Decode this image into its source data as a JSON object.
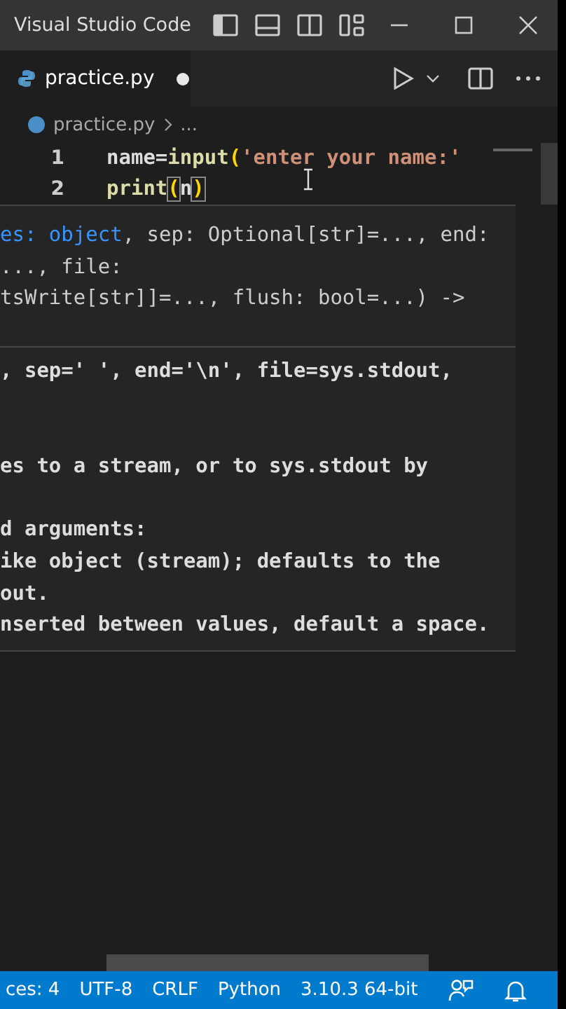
{
  "title_bar": {
    "title": "Visual Studio Code"
  },
  "tab": {
    "label": "practice.py",
    "modified": true
  },
  "breadcrumb": {
    "file": "practice.py",
    "rest": "..."
  },
  "code_lines": [
    {
      "number": "1",
      "segments": [
        {
          "text": "name",
          "kind": "variable"
        },
        {
          "text": "=",
          "kind": "operator"
        },
        {
          "text": "input",
          "kind": "function"
        },
        {
          "text": "(",
          "kind": "bracket"
        },
        {
          "text": "'enter your name:'",
          "kind": "string"
        }
      ]
    },
    {
      "number": "2",
      "segments": [
        {
          "text": "print",
          "kind": "function"
        },
        {
          "text": "(",
          "kind": "matched_bracket"
        },
        {
          "text": "n",
          "kind": "variable"
        },
        {
          "text": ")",
          "kind": "matched_bracket"
        }
      ]
    }
  ],
  "hover": {
    "signature": [
      [
        {
          "text": "es: object",
          "kind": "param"
        },
        {
          "text": ", sep: Optional[str]=..., end:",
          "kind": "plain"
        }
      ],
      [
        {
          "text": "..., file:",
          "kind": "plain"
        }
      ],
      [
        {
          "text": "tsWrite[str]]=..., flush: bool=...) ->",
          "kind": "plain"
        }
      ]
    ],
    "doc": [
      [
        ", sep=' ', end='\\n', file=sys.stdout,"
      ],
      [
        "es to a stream, or to sys.stdout by"
      ],
      [
        "d arguments:",
        "ike object (stream); defaults to the",
        "out.",
        "nserted between values, default a space."
      ]
    ]
  },
  "status_bar": {
    "items": [
      "ces: 4",
      "UTF-8",
      "CRLF",
      "Python",
      "3.10.3 64-bit"
    ]
  }
}
